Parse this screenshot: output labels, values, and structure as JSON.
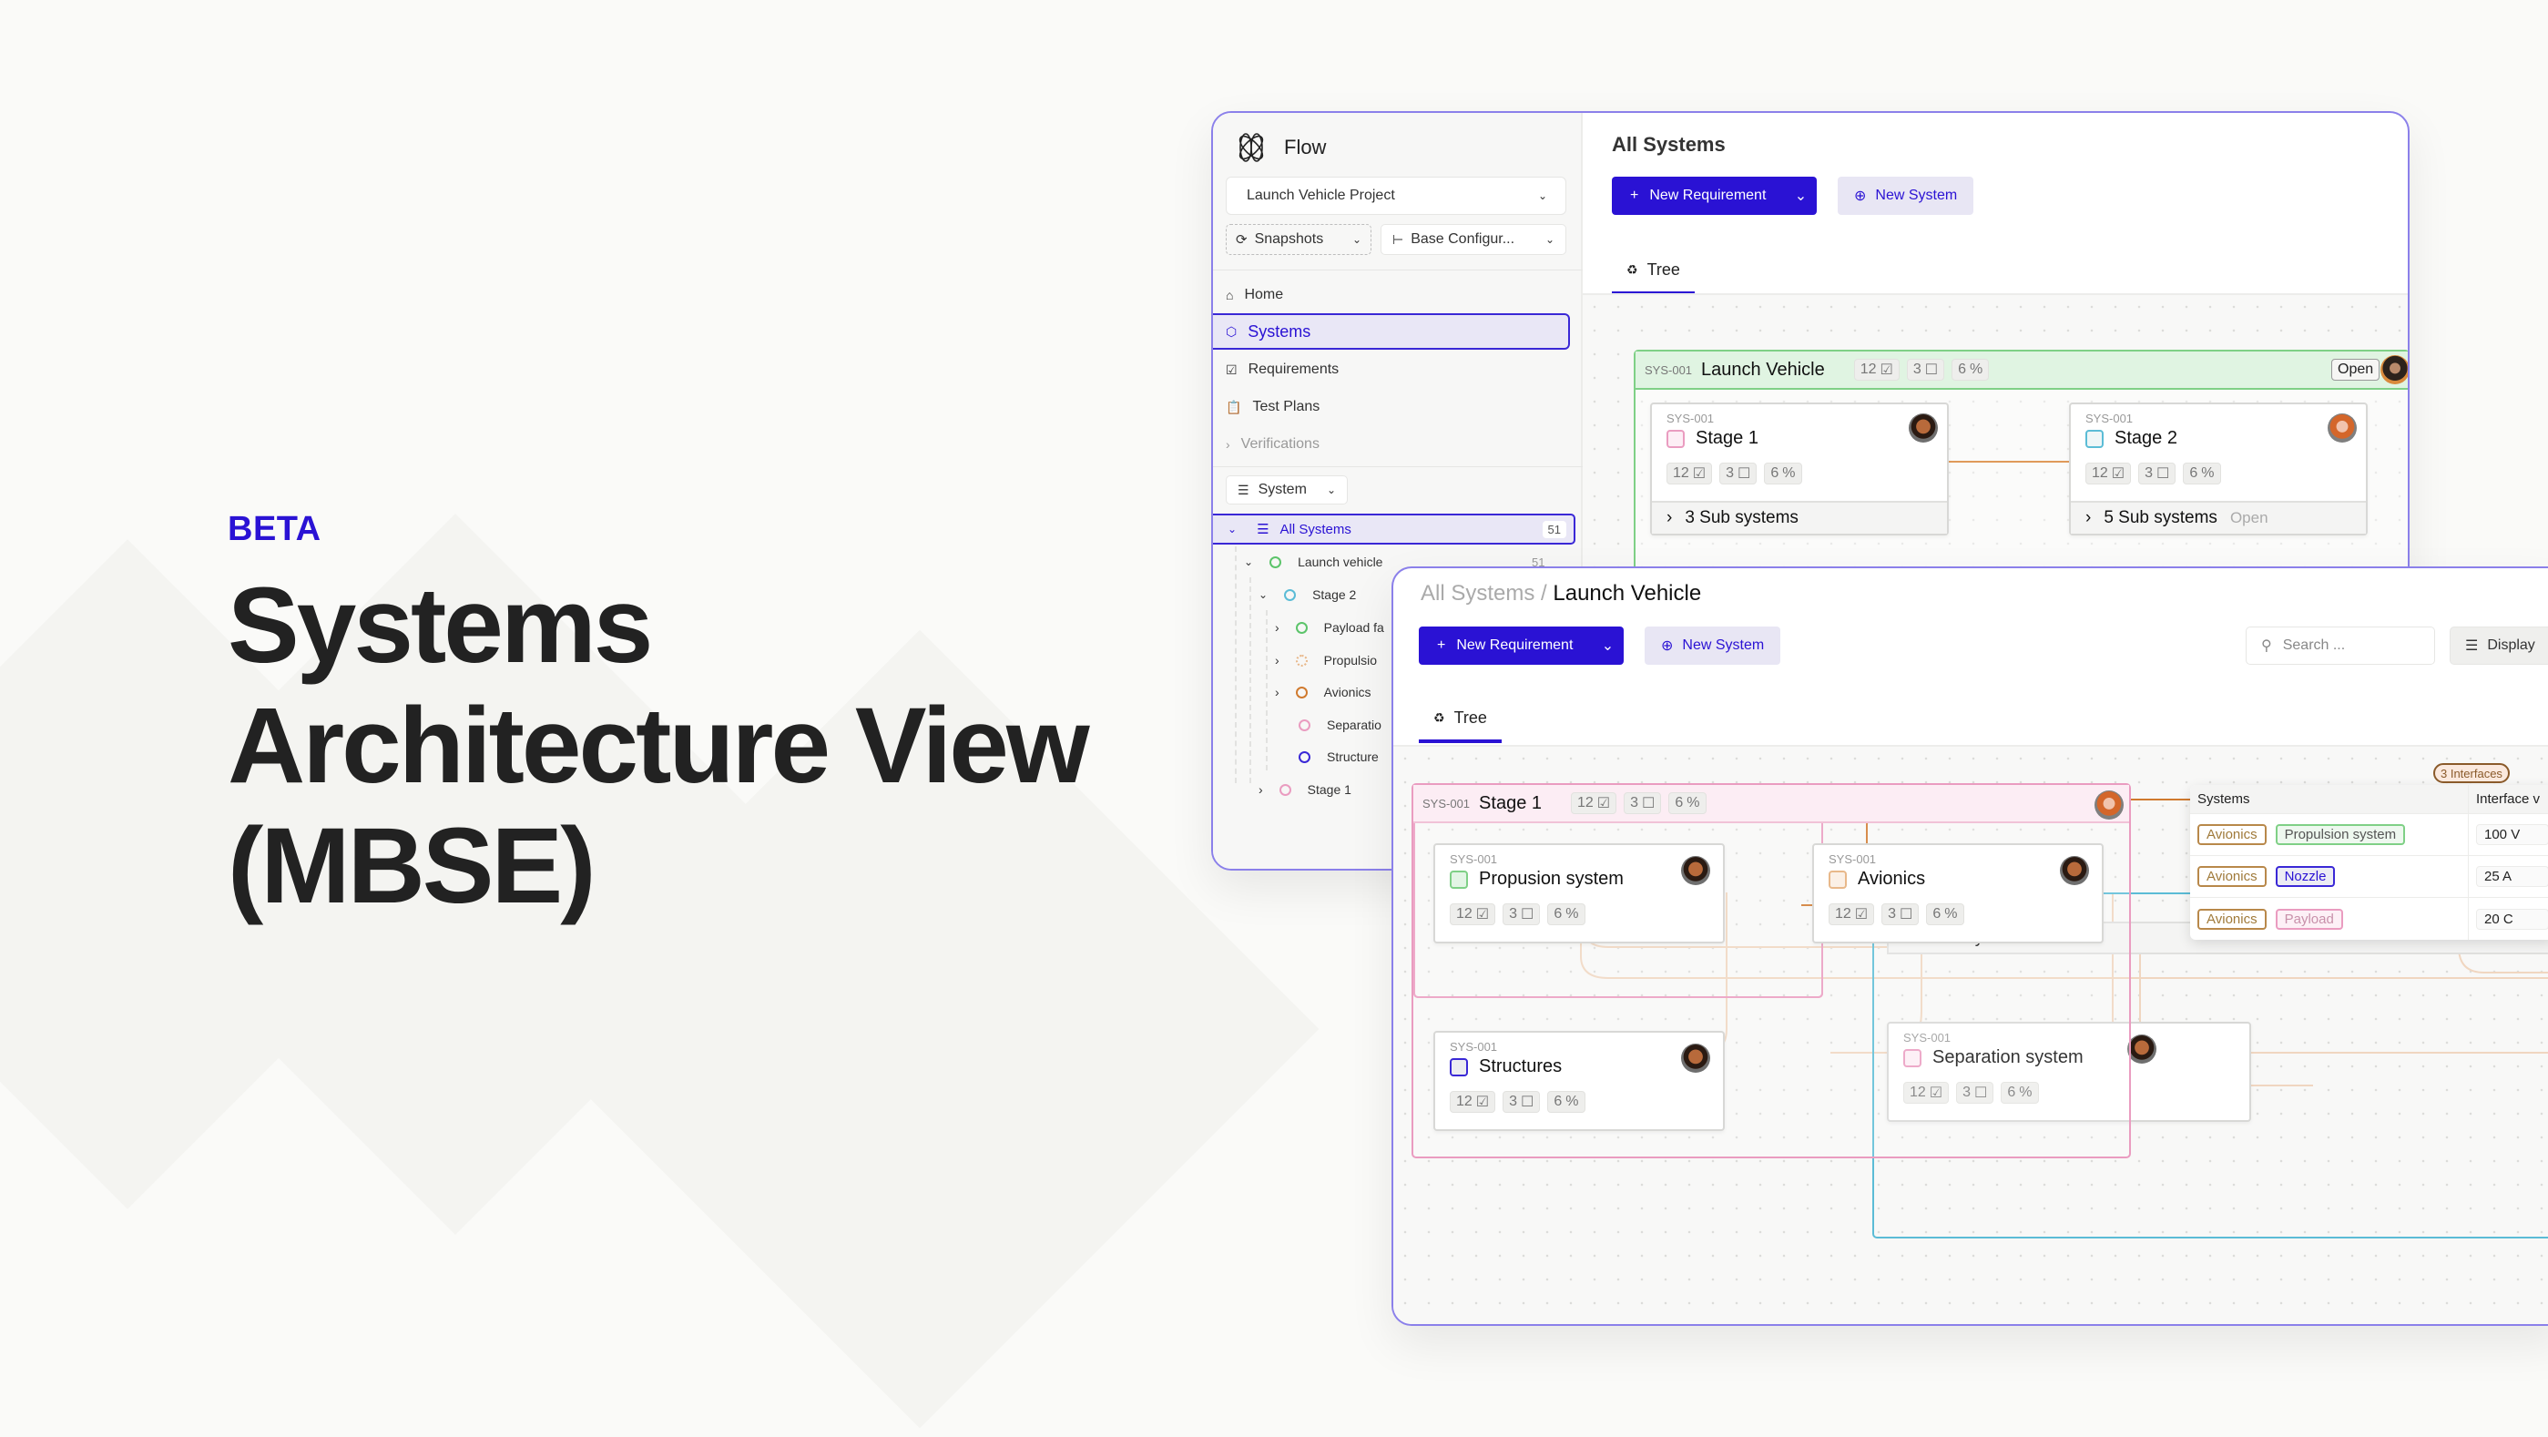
{
  "hero": {
    "badge": "BETA",
    "title_lines": [
      "Systems",
      "Architecture View",
      "(MBSE)"
    ],
    "badge_color": "#2a12d4"
  },
  "app": {
    "name": "Flow",
    "project": "Launch Vehicle Project",
    "snapshots_label": "Snapshots",
    "config_label": "Base Configur...",
    "nav": [
      {
        "label": "Home",
        "icon": "home-icon"
      },
      {
        "label": "Systems",
        "icon": "cube-icon",
        "active": true
      },
      {
        "label": "Requirements",
        "icon": "checkbox-icon"
      },
      {
        "label": "Test Plans",
        "icon": "clipboard-check-icon"
      },
      {
        "label": "Verifications",
        "icon": "chevron-right-icon"
      }
    ],
    "filter_label": "System",
    "tree": {
      "root": {
        "label": "All Systems",
        "count": "51"
      },
      "items": [
        {
          "label": "Launch vehicle",
          "count": "51",
          "color": "#5cc46a"
        },
        {
          "label": "Stage 2",
          "color": "#5bbcd6"
        },
        {
          "label": "Payload fa",
          "color": "#5cc46a"
        },
        {
          "label": "Propulsio",
          "color": "#e8b88a"
        },
        {
          "label": "Avionics",
          "color": "#d07a2e"
        },
        {
          "label": "Separatio",
          "color": "#ea9cc0"
        },
        {
          "label": "Structure",
          "color": "#3a28d6"
        },
        {
          "label": "Stage 1",
          "color": "#ea9cc0"
        }
      ]
    }
  },
  "back_view": {
    "title": "All Systems",
    "new_requirement": "New Requirement",
    "new_system": "New System",
    "tab": "Tree",
    "group": {
      "id": "SYS-001",
      "name": "Launch Vehicle",
      "requirements": "12",
      "tests": "3",
      "issues": "6",
      "status": "Open"
    },
    "cards": [
      {
        "id": "SYS-001",
        "name": "Stage 1",
        "requirements": "12",
        "tests": "3",
        "issues": "6",
        "footer": "3 Sub systems",
        "footer_status": ""
      },
      {
        "id": "SYS-001",
        "name": "Stage 2",
        "requirements": "12",
        "tests": "3",
        "issues": "6",
        "footer": "5 Sub systems",
        "footer_status": "Open"
      }
    ]
  },
  "front_view": {
    "breadcrumb_parent": "All Systems",
    "breadcrumb_sep": " / ",
    "breadcrumb_current": "Launch Vehicle",
    "new_requirement": "New Requirement",
    "new_system": "New System",
    "search_placeholder": "Search ...",
    "display_label": "Display",
    "tab": "Tree",
    "group": {
      "id": "SYS-001",
      "name": "Stage 1",
      "requirements": "12",
      "tests": "3",
      "issues": "6"
    },
    "cards": [
      {
        "id": "SYS-001",
        "name": "Propusion system",
        "requirements": "12",
        "tests": "3",
        "issues": "6"
      },
      {
        "id": "SYS-001",
        "name": "Avionics",
        "requirements": "12",
        "tests": "3",
        "issues": "6"
      },
      {
        "id": "SYS-001",
        "name": "Structures",
        "requirements": "12",
        "tests": "3",
        "issues": "6"
      },
      {
        "id": "SYS-001",
        "name": "Separation system",
        "requirements": "12",
        "tests": "3",
        "issues": "6"
      }
    ],
    "sub_system_footer": "1 Sub system",
    "interfaces": {
      "count_label": "3 Interfaces",
      "col_systems": "Systems",
      "col_value": "Interface v",
      "rows": [
        {
          "from": "Avionics",
          "to": "Propulsion system",
          "to_color": "#5cc46a",
          "value": "100 V"
        },
        {
          "from": "Avionics",
          "to": "Nozzle",
          "to_color": "#3a28d6",
          "value": "25 A"
        },
        {
          "from": "Avionics",
          "to": "Payload",
          "to_color": "#ea9cc0",
          "value": "20 C"
        }
      ]
    }
  },
  "colors": {
    "accent": "#2a12d4",
    "window_border": "#8b80ea",
    "green": "#5cc46a",
    "pink": "#ea9cc0",
    "cyan": "#5bbcd6",
    "orange": "#d07a2e"
  }
}
